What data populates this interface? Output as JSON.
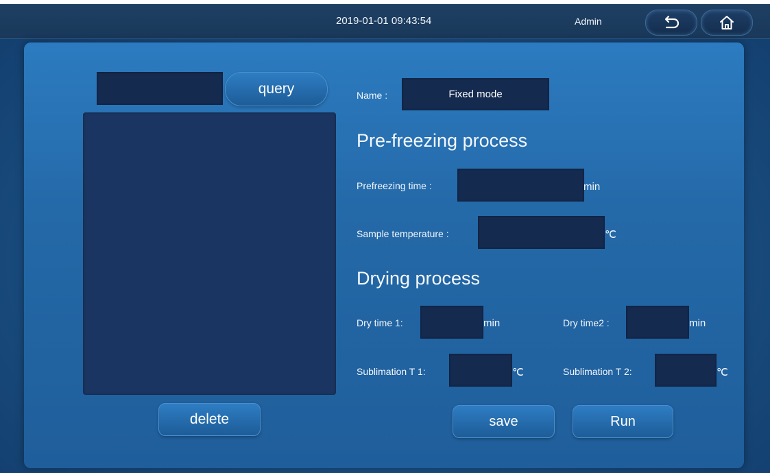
{
  "topbar": {
    "datetime": "2019-01-01 09:43:54",
    "user": "Admin",
    "back_icon": "back-arrow-icon",
    "home_icon": "home-icon"
  },
  "left": {
    "search_value": "",
    "query_label": "query",
    "delete_label": "delete",
    "records": []
  },
  "form": {
    "name_label": "Name :",
    "name_value": "Fixed mode",
    "prefreezing_title": "Pre-freezing process",
    "prefreezing_time_label": "Prefreezing time :",
    "prefreezing_time_value": "",
    "prefreezing_time_unit": "min",
    "sample_temp_label": "Sample temperature :",
    "sample_temp_value": "",
    "sample_temp_unit": "℃",
    "drying_title": "Drying process",
    "dry_time1_label": "Dry time 1:",
    "dry_time1_value": "",
    "dry_time1_unit": "min",
    "dry_time2_label": "Dry time2 :",
    "dry_time2_value": "",
    "dry_time2_unit": "min",
    "sub_t1_label": "Sublimation T 1:",
    "sub_t1_value": "",
    "sub_t1_unit": "℃",
    "sub_t2_label": "Sublimation T 2:",
    "sub_t2_value": "",
    "sub_t2_unit": "℃"
  },
  "actions": {
    "save_label": "save",
    "run_label": "Run"
  },
  "colors": {
    "panel": "#2469a8",
    "field": "#142a4f",
    "button": "#2e7dc3"
  }
}
